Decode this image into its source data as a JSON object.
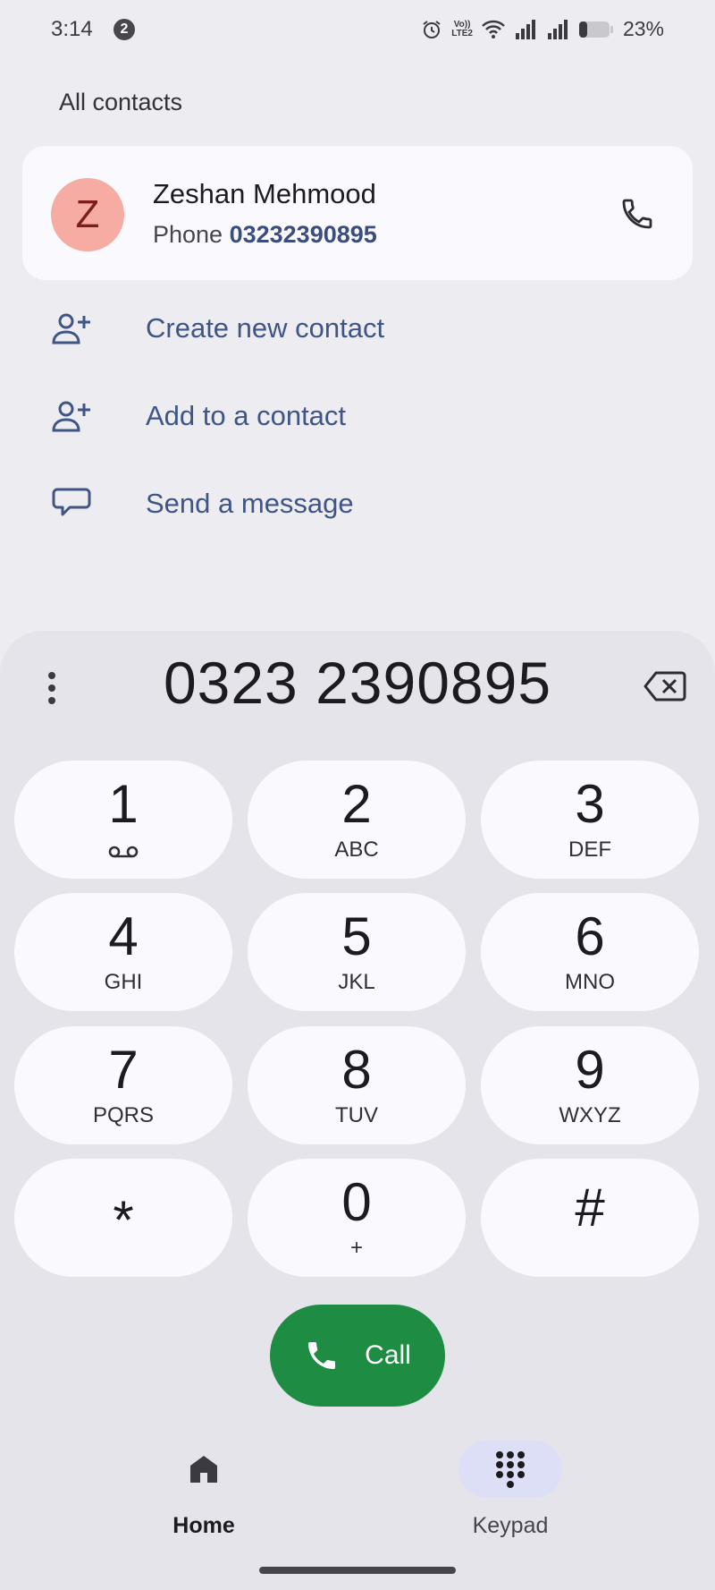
{
  "status_bar": {
    "time": "3:14",
    "notification_count": "2",
    "volte_line1": "Vo))",
    "volte_line2": "LTE2",
    "battery": "23%",
    "icons": [
      "alarm-icon",
      "volte-icon",
      "wifi-icon",
      "signal-icon",
      "signal-icon",
      "battery-icon"
    ]
  },
  "suggestions": {
    "section_label": "All contacts",
    "contact": {
      "initial": "Z",
      "name": "Zeshan Mehmood",
      "phone_label": "Phone",
      "phone_number": "03232390895",
      "avatar_color": "#f6aca3"
    },
    "actions": [
      {
        "label": "Create new contact",
        "icon": "person-add-icon"
      },
      {
        "label": "Add to a contact",
        "icon": "person-add-icon"
      },
      {
        "label": "Send a message",
        "icon": "message-icon"
      }
    ]
  },
  "dialer": {
    "number": "0323 2390895",
    "keys": [
      {
        "digit": "1",
        "letters": ""
      },
      {
        "digit": "2",
        "letters": "ABC"
      },
      {
        "digit": "3",
        "letters": "DEF"
      },
      {
        "digit": "4",
        "letters": "GHI"
      },
      {
        "digit": "5",
        "letters": "JKL"
      },
      {
        "digit": "6",
        "letters": "MNO"
      },
      {
        "digit": "7",
        "letters": "PQRS"
      },
      {
        "digit": "8",
        "letters": "TUV"
      },
      {
        "digit": "9",
        "letters": "WXYZ"
      },
      {
        "digit": "*",
        "letters": ""
      },
      {
        "digit": "0",
        "letters": "+"
      },
      {
        "digit": "#",
        "letters": ""
      }
    ],
    "call_label": "Call",
    "call_color": "#1f8c43"
  },
  "bottom_nav": {
    "items": [
      {
        "label": "Home",
        "icon": "home-icon"
      },
      {
        "label": "Keypad",
        "icon": "dialpad-icon"
      }
    ]
  }
}
